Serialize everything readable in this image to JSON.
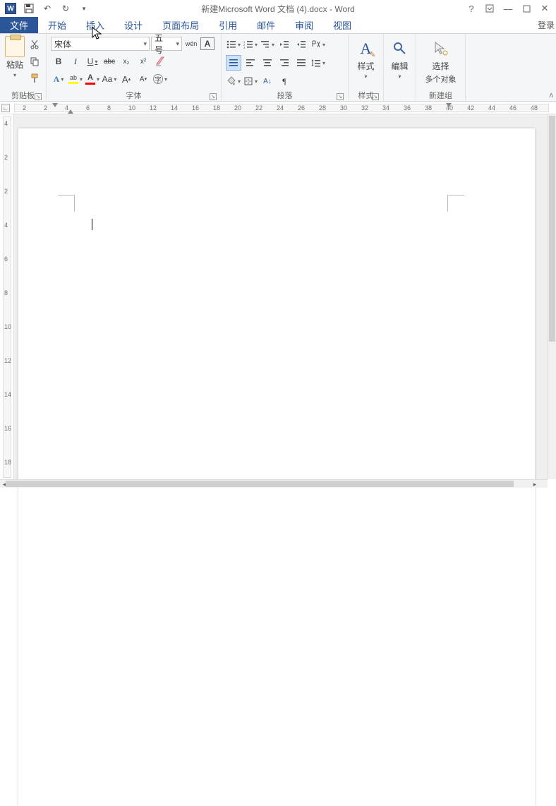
{
  "title": "新建Microsoft Word 文档 (4).docx - Word",
  "signin": "登录",
  "tabs": {
    "file": "文件",
    "home": "开始",
    "insert": "插入",
    "design": "设计",
    "layout": "页面布局",
    "references": "引用",
    "mailings": "邮件",
    "review": "审阅",
    "view": "视图"
  },
  "groups": {
    "clipboard": {
      "label": "剪贴板",
      "paste": "粘贴"
    },
    "font": {
      "label": "字体",
      "name": "宋体",
      "size": "五号",
      "bold": "B",
      "italic": "I",
      "underline": "U",
      "strike": "abc",
      "sub": "x₂",
      "sup": "x²",
      "charA": "A",
      "aa": "Aa",
      "growA": "A",
      "shrinkA": "A",
      "wen": "wén"
    },
    "paragraph": {
      "label": "段落"
    },
    "styles": {
      "label": "样式",
      "btn": "样式"
    },
    "editing": {
      "btn": "编辑"
    },
    "newgroup": {
      "label": "新建组",
      "select": "选择",
      "multi": "多个对象"
    }
  },
  "ruler": {
    "h": [
      "2",
      "2",
      "4",
      "6",
      "8",
      "10",
      "12",
      "14",
      "16",
      "18",
      "20",
      "22",
      "24",
      "26",
      "28",
      "30",
      "32",
      "34",
      "36",
      "38",
      "40",
      "42",
      "44",
      "46",
      "48"
    ],
    "v": [
      "4",
      "2",
      "2",
      "4",
      "6",
      "8",
      "10",
      "12",
      "14",
      "16",
      "18"
    ]
  }
}
